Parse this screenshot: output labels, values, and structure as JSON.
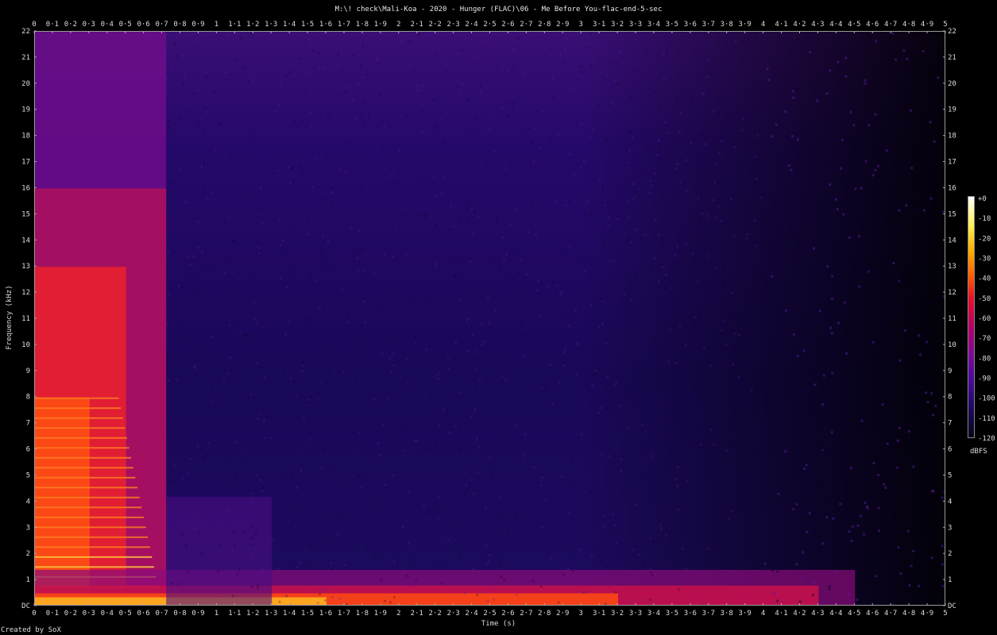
{
  "title": "M:\\! check\\Mali-Koa - 2020 - Hunger (FLAC)\\06 - Me Before You-flac-end-5-sec",
  "footer": "Created by SoX",
  "chart_data": {
    "type": "heatmap",
    "title": "M:\\! check\\Mali-Koa - 2020 - Hunger (FLAC)\\06 - Me Before You-flac-end-5-sec",
    "xlabel": "Time (s)",
    "ylabel": "Frequency (kHz)",
    "xlim": [
      0,
      5
    ],
    "ylim": [
      0,
      22
    ],
    "x_ticks": [
      "0",
      "0·1",
      "0·2",
      "0·3",
      "0·4",
      "0·5",
      "0·6",
      "0·7",
      "0·8",
      "0·9",
      "1",
      "1·1",
      "1·2",
      "1·3",
      "1·4",
      "1·5",
      "1·6",
      "1·7",
      "1·8",
      "1·9",
      "2",
      "2·1",
      "2·2",
      "2·3",
      "2·4",
      "2·5",
      "2·6",
      "2·7",
      "2·8",
      "2·9",
      "3",
      "3·1",
      "3·2",
      "3·3",
      "3·4",
      "3·5",
      "3·6",
      "3·7",
      "3·8",
      "3·9",
      "4",
      "4·1",
      "4·2",
      "4·3",
      "4·4",
      "4·5",
      "4·6",
      "4·7",
      "4·8",
      "4·9",
      "5"
    ],
    "y_ticks": [
      "DC",
      "1",
      "2",
      "3",
      "4",
      "5",
      "6",
      "7",
      "8",
      "9",
      "10",
      "11",
      "12",
      "13",
      "14",
      "15",
      "16",
      "17",
      "18",
      "19",
      "20",
      "21",
      "22"
    ],
    "colorbar": {
      "label": "dBFS",
      "ticks": [
        "+0",
        "-10",
        "-20",
        "-30",
        "-40",
        "-50",
        "-60",
        "-70",
        "-80",
        "-90",
        "-100",
        "-110",
        "-120"
      ],
      "range": [
        -120,
        0
      ]
    },
    "colors": {
      "background": "#000000",
      "noise": "#24096a",
      "mid": "#d0104a",
      "high": "#ffee55"
    }
  }
}
